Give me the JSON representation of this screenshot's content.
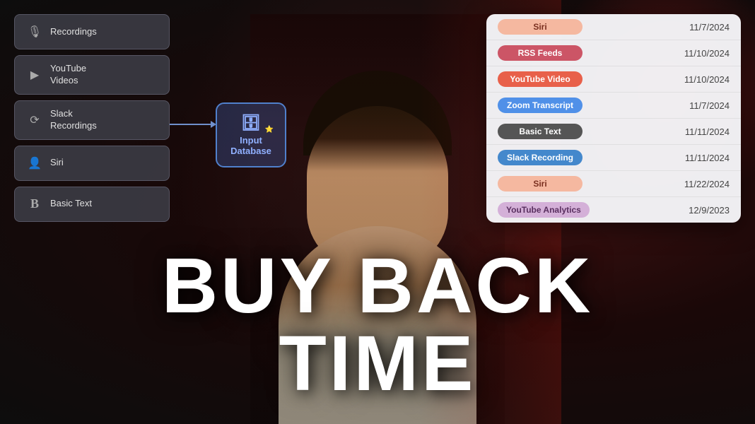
{
  "background": {
    "color": "#1a0a0a"
  },
  "leftPanel": {
    "nodes": [
      {
        "id": "recordings",
        "label": "Recordings",
        "icon": "🎙️"
      },
      {
        "id": "youtube",
        "label": "YouTube\nVideos",
        "icon": "▶️"
      },
      {
        "id": "slack",
        "label": "Slack\nRecordings",
        "icon": "🔄"
      },
      {
        "id": "siri",
        "label": "Siri",
        "icon": "👤"
      },
      {
        "id": "basic",
        "label": "Basic Text",
        "icon": "B"
      }
    ]
  },
  "databaseNode": {
    "label": "Input\nDatabase",
    "icon": "🗄️"
  },
  "bigText": {
    "line1": "BUY BACK",
    "line2": "TIME"
  },
  "rightPanel": {
    "rows": [
      {
        "tag": "Siri",
        "tagClass": "tag-siri",
        "date": "11/7/2024"
      },
      {
        "tag": "RSS Feeds",
        "tagClass": "tag-rss",
        "date": "11/10/2024"
      },
      {
        "tag": "YouTube Video",
        "tagClass": "tag-youtube",
        "date": "11/10/2024"
      },
      {
        "tag": "Zoom Transcript",
        "tagClass": "tag-zoom",
        "date": "11/7/2024"
      },
      {
        "tag": "Basic Text",
        "tagClass": "tag-basic",
        "date": "11/11/2024"
      },
      {
        "tag": "Slack Recording",
        "tagClass": "tag-slack",
        "date": "11/11/2024"
      },
      {
        "tag": "Siri",
        "tagClass": "tag-siri",
        "date": "11/22/2024"
      },
      {
        "tag": "YouTube Analytics",
        "tagClass": "tag-analytics",
        "date": "12/9/2023"
      }
    ]
  }
}
